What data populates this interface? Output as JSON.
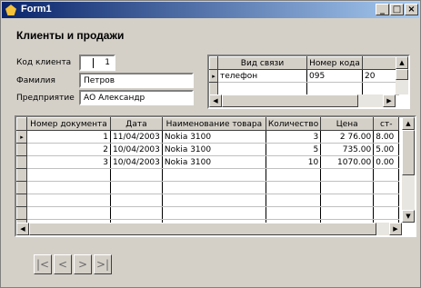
{
  "window": {
    "title": "Form1",
    "min": "_",
    "max": "□",
    "close": "×"
  },
  "heading": "Клиенты и продажи",
  "form": {
    "code_label": "Код клиента",
    "code_value": "1",
    "surname_label": "Фамилия",
    "surname_value": "Петров",
    "company_label": "Предприятие",
    "company_value": "АО Александр"
  },
  "contacts": {
    "columns": [
      "Вид связи",
      "Номер кода",
      ""
    ],
    "rows": [
      {
        "type": "телефон",
        "code": "095",
        "extra": "20"
      }
    ]
  },
  "sales": {
    "columns": [
      "Номер документа",
      "Дата",
      "Наименование товара",
      "Количество",
      "Цена",
      "ст-"
    ],
    "rows": [
      {
        "doc": "1",
        "date": "11/04/2003",
        "product": "Nokia 3100",
        "qty": "3",
        "price": "2 76.00",
        "sum": "8.00"
      },
      {
        "doc": "2",
        "date": "10/04/2003",
        "product": "Nokia 3100",
        "qty": "5",
        "price": "735.00",
        "sum": "5.00"
      },
      {
        "doc": "3",
        "date": "10/04/2003",
        "product": "Nokia 3100",
        "qty": "10",
        "price": "1070.00",
        "sum": "0.00"
      }
    ]
  },
  "navigator": {
    "first": "|<",
    "prev": "<",
    "next": ">",
    "last": ">|"
  }
}
